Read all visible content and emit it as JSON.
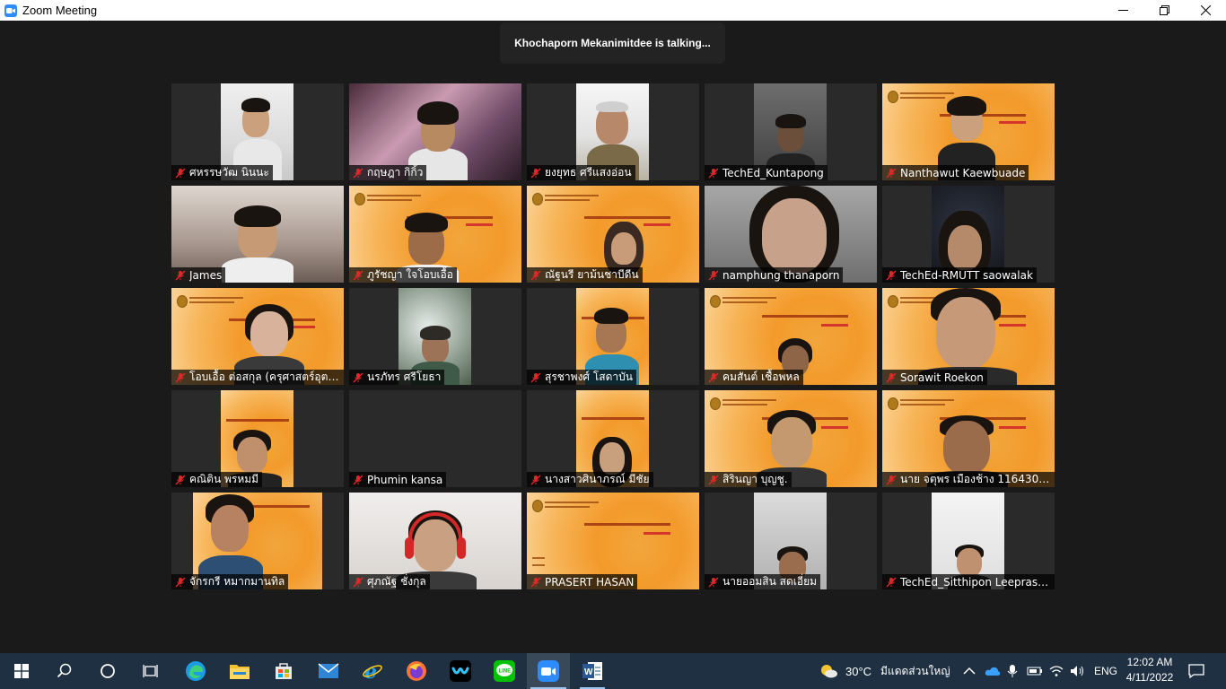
{
  "window": {
    "title": "Zoom Meeting"
  },
  "talking_indicator": "Khochaporn Mekanimitdee is talking...",
  "participants": [
    {
      "name": "ศหรรษวัฒ นินนะ",
      "muted": true
    },
    {
      "name": "กฤษฎา กิกิ้ว",
      "muted": true
    },
    {
      "name": "ยงยุทธ ศรีแสงอ่อน",
      "muted": true
    },
    {
      "name": "TechEd_Kuntapong",
      "muted": true
    },
    {
      "name": "Nanthawut Kaewbuade",
      "muted": true
    },
    {
      "name": "James",
      "muted": true
    },
    {
      "name": "ภูรัชญา ใจโอบเอื้อ",
      "muted": true
    },
    {
      "name": "ณัฐนรี ยาม้นชาบีดีน",
      "muted": true
    },
    {
      "name": "namphung thanaporn",
      "muted": true
    },
    {
      "name": "TechEd-RMUTT saowalak",
      "muted": true
    },
    {
      "name": "โอบเอื้อ ต่อสกุล (ครุศาสตร์อุตสา...",
      "muted": true
    },
    {
      "name": "นรภัทร ศรีโยธา",
      "muted": true
    },
    {
      "name": "สุรชาพงศ์ โสดาบัน",
      "muted": true
    },
    {
      "name": "คมสันต์ เชื้อพหล",
      "muted": true
    },
    {
      "name": "Sorawit Roekon",
      "muted": true
    },
    {
      "name": "คณิติน พรหมมี",
      "muted": true
    },
    {
      "name": "Phumin kansa",
      "muted": true
    },
    {
      "name": "นางสาวศินาภรณ์ มีชัย",
      "muted": true
    },
    {
      "name": "สิรินญา บุญชู.",
      "muted": true
    },
    {
      "name": "นาย จตุพร เมืองช้าง 1164302...",
      "muted": true
    },
    {
      "name": "จักรกรี หมากมานทิล",
      "muted": true
    },
    {
      "name": "ศุภณัฐ ชั่งกุล",
      "muted": true
    },
    {
      "name": "PRASERT HASAN",
      "muted": true
    },
    {
      "name": "นายออมสิน สดเอี่ยม",
      "muted": true
    },
    {
      "name": "TechEd_Sitthipon Leeprasert",
      "muted": true
    }
  ],
  "taskbar": {
    "apps": [
      "start-icon",
      "search-icon",
      "cortana-icon",
      "task-view-icon",
      "edge-icon",
      "file-explorer-icon",
      "store-icon",
      "mail-icon",
      "internet-explorer-icon",
      "firefox-icon",
      "webex-icon",
      "line-icon",
      "zoom-icon",
      "word-icon"
    ],
    "weather": {
      "temp": "30°C",
      "text": "มีแดดส่วนใหญ่"
    },
    "language": "ENG",
    "time": "12:02 AM",
    "date": "4/11/2022"
  },
  "colors": {
    "mic_muted": "#e02828",
    "zoom_blue": "#2d8cff",
    "taskbar": "#1e3042"
  }
}
